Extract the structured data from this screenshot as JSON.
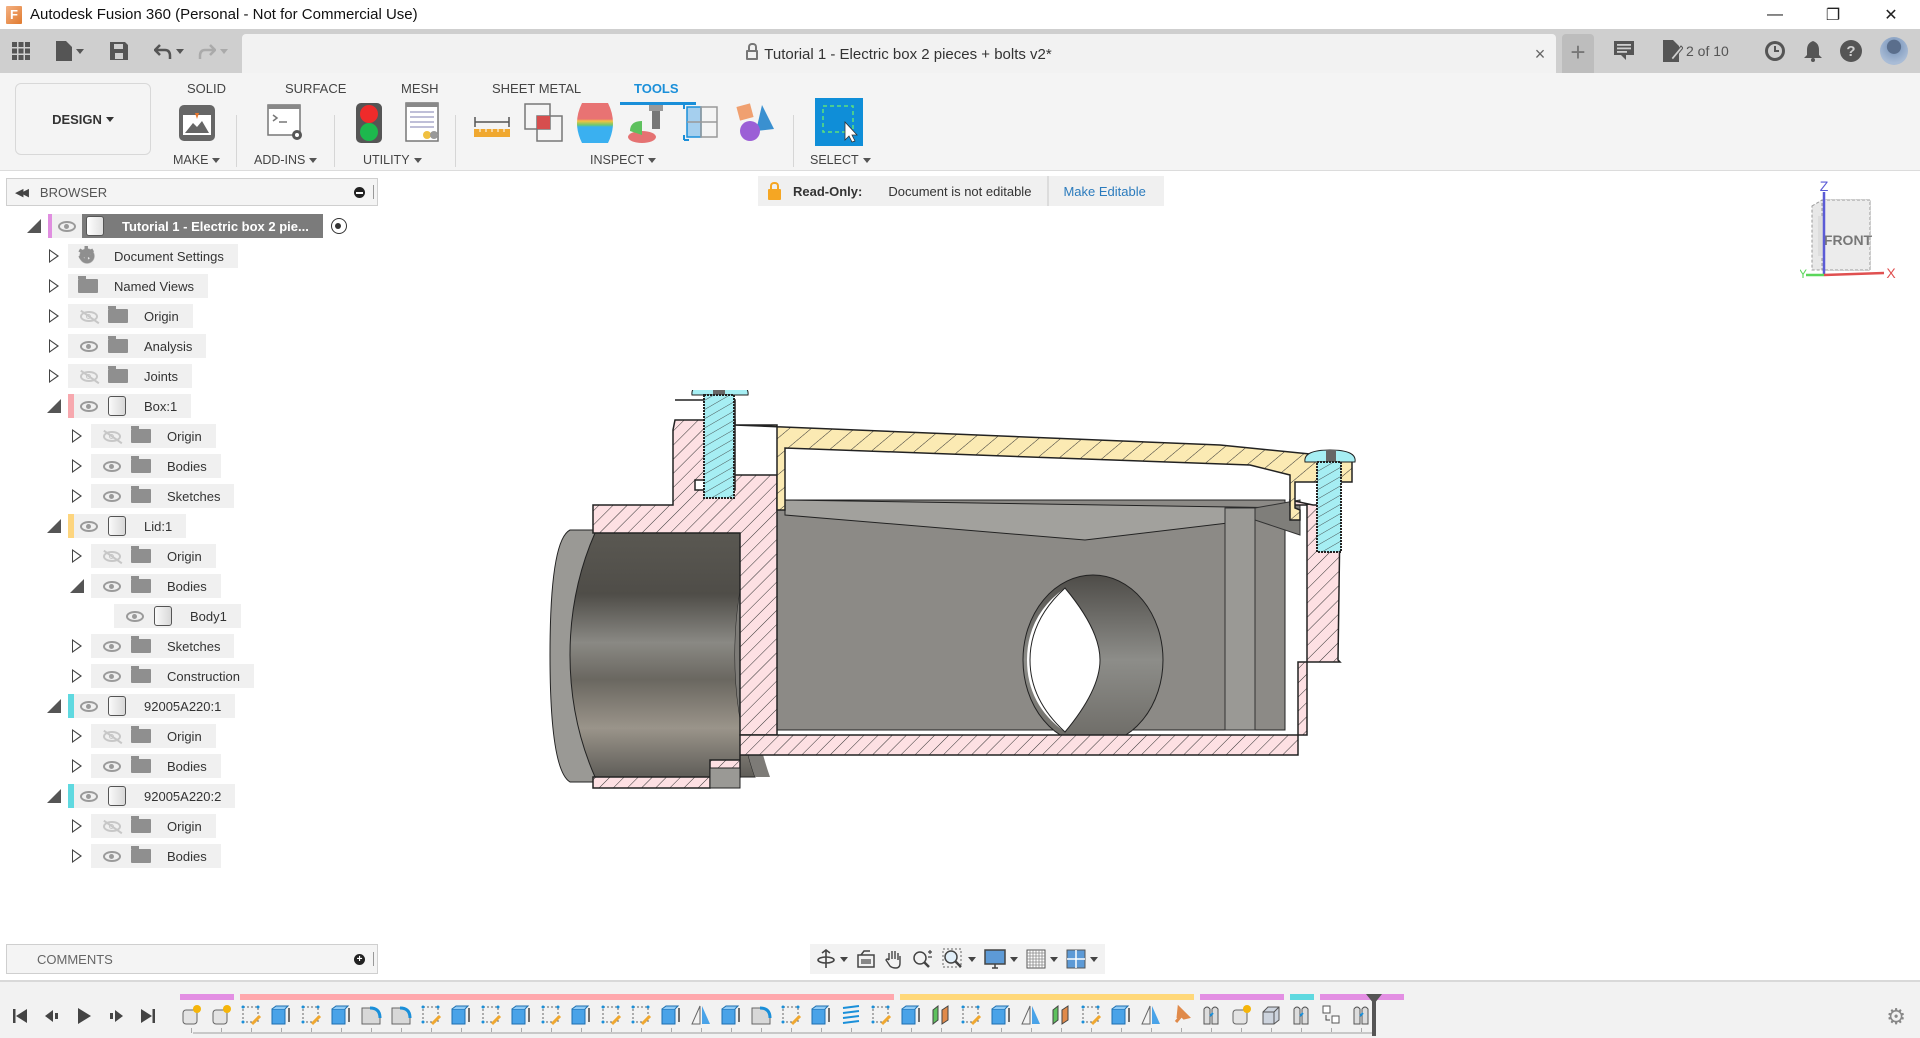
{
  "window": {
    "app_title": "Autodesk Fusion 360 (Personal - Not for Commercial Use)",
    "app_icon_letter": "F",
    "controls": {
      "minimize": "—",
      "maximize": "❐",
      "close": "✕"
    }
  },
  "appbar": {
    "document_tab_title": "Tutorial 1 - Electric box 2 pieces + bolts v2*",
    "tab_close": "×",
    "new_tab": "+",
    "job_status": "2 of 10"
  },
  "ribbon": {
    "workspace": "DESIGN",
    "tabs": [
      {
        "label": "SOLID",
        "active": false
      },
      {
        "label": "SURFACE",
        "active": false
      },
      {
        "label": "MESH",
        "active": false
      },
      {
        "label": "SHEET METAL",
        "active": false
      },
      {
        "label": "TOOLS",
        "active": true
      }
    ],
    "groups": [
      {
        "label": "MAKE",
        "tools": [
          "3d-print"
        ]
      },
      {
        "label": "ADD-INS",
        "tools": [
          "scripts-and-add-ins"
        ]
      },
      {
        "label": "UTILITY",
        "tools": [
          "compute-all",
          "bill-of-materials"
        ]
      },
      {
        "label": "INSPECT",
        "tools": [
          "measure",
          "interference",
          "curvature-comb",
          "accessibility-analysis",
          "section-analysis",
          "display-component-colors"
        ]
      },
      {
        "label": "SELECT",
        "tools": [
          "select"
        ]
      }
    ]
  },
  "browser": {
    "title": "BROWSER",
    "root": {
      "label": "Tutorial 1 - Electric box 2 pie...",
      "color": "#e08ee0"
    },
    "items": [
      {
        "label": "Document Settings",
        "level": 1,
        "icon": "gear",
        "expanded": false,
        "visible": null
      },
      {
        "label": "Named Views",
        "level": 1,
        "icon": "folder",
        "expanded": false,
        "visible": null
      },
      {
        "label": "Origin",
        "level": 1,
        "icon": "folder",
        "expanded": false,
        "visible": false
      },
      {
        "label": "Analysis",
        "level": 1,
        "icon": "folder",
        "expanded": false,
        "visible": true
      },
      {
        "label": "Joints",
        "level": 1,
        "icon": "folder",
        "expanded": false,
        "visible": false
      },
      {
        "label": "Box:1",
        "level": 1,
        "icon": "component",
        "expanded": true,
        "visible": true,
        "color": "#f7a8ae"
      },
      {
        "label": "Origin",
        "level": 2,
        "icon": "folder",
        "expanded": false,
        "visible": false
      },
      {
        "label": "Bodies",
        "level": 2,
        "icon": "folder",
        "expanded": false,
        "visible": true
      },
      {
        "label": "Sketches",
        "level": 2,
        "icon": "folder",
        "expanded": false,
        "visible": true
      },
      {
        "label": "Lid:1",
        "level": 1,
        "icon": "component",
        "expanded": true,
        "visible": true,
        "color": "#fdd57e"
      },
      {
        "label": "Origin",
        "level": 2,
        "icon": "folder",
        "expanded": false,
        "visible": false
      },
      {
        "label": "Bodies",
        "level": 2,
        "icon": "folder",
        "expanded": true,
        "visible": true
      },
      {
        "label": "Body1",
        "level": 3,
        "icon": "body",
        "expanded": null,
        "visible": true
      },
      {
        "label": "Sketches",
        "level": 2,
        "icon": "folder",
        "expanded": false,
        "visible": true
      },
      {
        "label": "Construction",
        "level": 2,
        "icon": "folder",
        "expanded": false,
        "visible": true
      },
      {
        "label": "92005A220:1",
        "level": 1,
        "icon": "component",
        "expanded": true,
        "visible": true,
        "color": "#5fd9e0"
      },
      {
        "label": "Origin",
        "level": 2,
        "icon": "folder",
        "expanded": false,
        "visible": false
      },
      {
        "label": "Bodies",
        "level": 2,
        "icon": "folder",
        "expanded": false,
        "visible": true
      },
      {
        "label": "92005A220:2",
        "level": 1,
        "icon": "component",
        "expanded": true,
        "visible": true,
        "color": "#5fd9e0"
      },
      {
        "label": "Origin",
        "level": 2,
        "icon": "folder",
        "expanded": false,
        "visible": false
      },
      {
        "label": "Bodies",
        "level": 2,
        "icon": "folder",
        "expanded": false,
        "visible": true
      }
    ]
  },
  "readonly_banner": {
    "label": "Read-Only:",
    "message": "Document is not editable",
    "action": "Make Editable"
  },
  "viewcube": {
    "face": "FRONT",
    "axes": {
      "z": "Z",
      "x": "X",
      "y": "Y"
    },
    "colors": {
      "z": "#5b5bd6",
      "x": "#e05050",
      "y": "#5bd65b"
    }
  },
  "comments": {
    "title": "COMMENTS"
  },
  "navbar": {
    "tools": [
      "orbit",
      "look-at",
      "pan",
      "zoom",
      "fit",
      "display-settings",
      "grid-and-snaps",
      "viewports"
    ]
  },
  "timeline": {
    "controls": [
      "go-to-start",
      "step-back",
      "play",
      "step-forward",
      "go-to-end"
    ],
    "groups": [
      {
        "color": "#e38fe3",
        "count": 2
      },
      {
        "color": "#ffa8ad",
        "count": 22
      },
      {
        "color": "#ffd87a",
        "count": 10
      },
      {
        "color": "#e38fe3",
        "count": 3
      },
      {
        "color": "#5fd9e0",
        "count": 1
      },
      {
        "color": "#e38fe3",
        "count": 3
      }
    ],
    "features": [
      "component",
      "component",
      "sketch",
      "extrude",
      "sketch",
      "extrude",
      "fillet",
      "fillet",
      "sketch",
      "extrude",
      "sketch",
      "extrude",
      "sketch",
      "extrude",
      "sketch",
      "sketch",
      "extrude",
      "mirror",
      "extrude",
      "fillet",
      "sketch",
      "extrude",
      "thread",
      "sketch",
      "extrude",
      "split",
      "sketch",
      "extrude",
      "mirror",
      "split",
      "sketch",
      "extrude",
      "mirror",
      "pin",
      "joint",
      "component",
      "box",
      "joint",
      "align",
      "joint"
    ]
  },
  "model": {
    "colors": {
      "box_section": "#fde0e3",
      "lid_section": "#fbeab3",
      "bolt_section": "#a6eef3",
      "body_gray": "#8c8a86",
      "hatch": "#333333"
    }
  }
}
